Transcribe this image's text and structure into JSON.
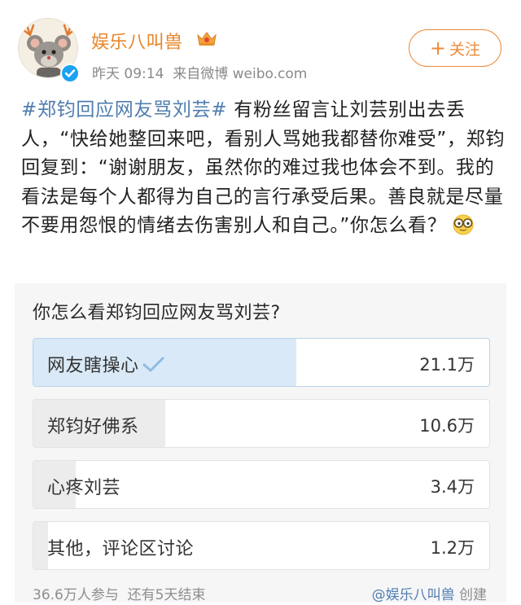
{
  "header": {
    "username": "娱乐八叫兽",
    "time": "昨天 09:14",
    "source": "来自微博 weibo.com",
    "follow_label": "关注"
  },
  "post": {
    "hashtag": "#郑钧回应网友骂刘芸#",
    "text": " 有粉丝留言让刘芸别出去丢人，“快给她整回来吧，看别人骂她我都替你难受”，郑钧回复到：“谢谢朋友，虽然你的难过我也体会不到。我的看法是每个人都得为自己的言行承受后果。善良就是尽量不要用怨恨的情绪去伤害别人和自己。”你怎么看？"
  },
  "poll": {
    "question": "你怎么看郑钧回应网友骂刘芸?",
    "options": [
      {
        "label": "网友瞎操心",
        "count": "21.1万",
        "share": 0.577,
        "selected": true
      },
      {
        "label": "郑钧好佛系",
        "count": "10.6万",
        "share": 0.29,
        "selected": false
      },
      {
        "label": "心疼刘芸",
        "count": "3.4万",
        "share": 0.093,
        "selected": false
      },
      {
        "label": "其他，评论区讨论",
        "count": "1.2万",
        "share": 0.033,
        "selected": false
      }
    ],
    "participants": "36.6万人参与",
    "remaining": "还有5天结束",
    "creator": "@娱乐八叫兽",
    "creator_suffix": "创建"
  },
  "colors": {
    "username": "#e8862a",
    "hashtag": "#507daf",
    "follow": "#ee8a3a",
    "selected_fill": "#d9e9f7"
  }
}
